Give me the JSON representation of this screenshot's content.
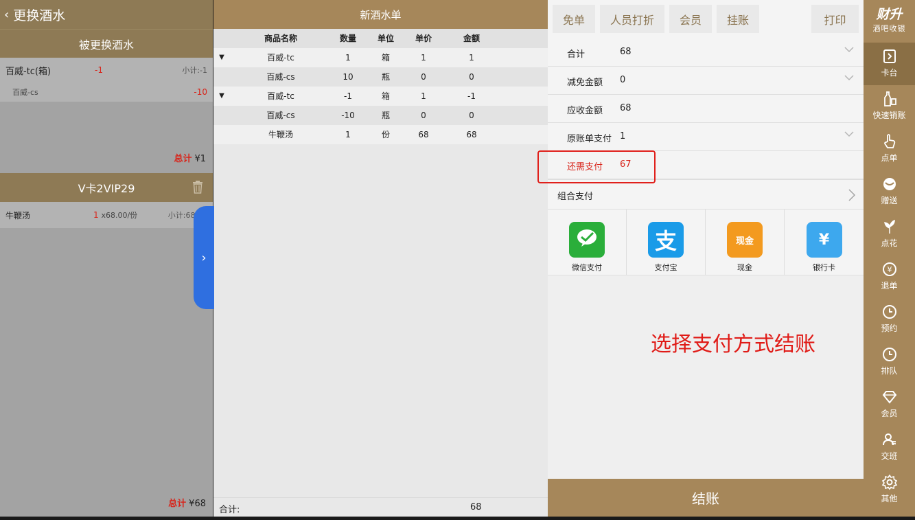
{
  "left": {
    "back_icon": "chevron-left-icon",
    "title": "更换酒水",
    "replaced_header": "被更换酒水",
    "replaced_items": [
      {
        "name": "百威-tc(箱)",
        "qty": "-1",
        "subtotal": "小计:-1"
      },
      {
        "name": "百威-cs",
        "qty": "",
        "subtotal": "-10"
      }
    ],
    "total1_label": "总计",
    "total1_value": "¥1",
    "card_name": "V卡2VIP29",
    "trash_icon": "trash-icon",
    "card_item": {
      "name": "牛鞭汤",
      "qty": "1",
      "unit_price": "x68.00/份",
      "subtotal": "小计:68.00"
    },
    "total2_label": "总计",
    "total2_value": "¥68"
  },
  "center": {
    "title": "新酒水单",
    "columns": [
      "商品名称",
      "数量",
      "单位",
      "单价",
      "金额"
    ],
    "rows": [
      {
        "tri": "▼",
        "name": "百威-tc",
        "qty": "1",
        "unit": "箱",
        "price": "1",
        "amount": "1"
      },
      {
        "tri": "",
        "name": "百威-cs",
        "qty": "10",
        "unit": "瓶",
        "price": "0",
        "amount": "0"
      },
      {
        "tri": "▼",
        "name": "百威-tc",
        "qty": "-1",
        "unit": "箱",
        "price": "1",
        "amount": "-1"
      },
      {
        "tri": "",
        "name": "百威-cs",
        "qty": "-10",
        "unit": "瓶",
        "price": "0",
        "amount": "0"
      },
      {
        "tri": "",
        "name": "牛鞭汤",
        "qty": "1",
        "unit": "份",
        "price": "68",
        "amount": "68"
      }
    ],
    "footer_label": "合计:",
    "footer_value": "68"
  },
  "right": {
    "toolbar": {
      "free": "免单",
      "staff_discount": "人员打折",
      "member": "会员",
      "on_account": "挂账",
      "print": "打印"
    },
    "summary": [
      {
        "label": "合计",
        "value": "68"
      },
      {
        "label": "减免金额",
        "value": "0"
      },
      {
        "label": "应收金额",
        "value": "68"
      },
      {
        "label": "原账单支付",
        "value": "1"
      },
      {
        "label": "还需支付",
        "value": "67"
      }
    ],
    "combo_label": "组合支付",
    "payments": [
      {
        "label": "微信支付",
        "icon": "wechat-pay-icon",
        "color": "#2aae3a",
        "glyph": "微信支付"
      },
      {
        "label": "支付宝",
        "icon": "alipay-icon",
        "color": "#1a9be8",
        "glyph": "支"
      },
      {
        "label": "现金",
        "icon": "cash-icon",
        "color": "#f39a1f",
        "glyph": "现金"
      },
      {
        "label": "银行卡",
        "icon": "bank-card-icon",
        "color": "#3da8ee",
        "glyph": "¥"
      }
    ],
    "hint": "选择支付方式结账",
    "checkout": "结账"
  },
  "sidebar": {
    "logo": "财升",
    "logo_sub": "酒吧收银",
    "items": [
      {
        "label": "卡台",
        "icon": "table-icon"
      },
      {
        "label": "快速销账",
        "icon": "quick-checkout-icon"
      },
      {
        "label": "点单",
        "icon": "order-icon"
      },
      {
        "label": "赠送",
        "icon": "gift-icon"
      },
      {
        "label": "点花",
        "icon": "flower-icon"
      },
      {
        "label": "退单",
        "icon": "refund-icon"
      },
      {
        "label": "预约",
        "icon": "reserve-icon"
      },
      {
        "label": "排队",
        "icon": "queue-icon"
      },
      {
        "label": "会员",
        "icon": "diamond-icon"
      },
      {
        "label": "交班",
        "icon": "shift-icon"
      },
      {
        "label": "其他",
        "icon": "gear-icon"
      }
    ]
  },
  "colors": {
    "brand": "#a6875a",
    "accent_red": "#d8241a",
    "blue_tab": "#2f6fe0"
  }
}
